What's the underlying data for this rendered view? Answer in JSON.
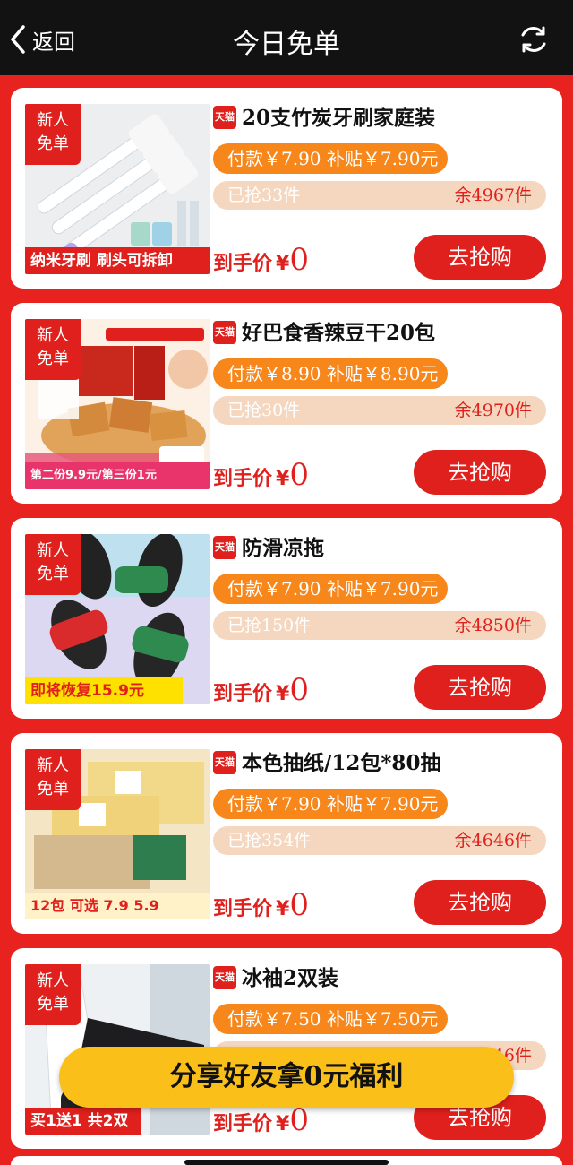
{
  "nav": {
    "back_label": "返回",
    "title": "今日免单"
  },
  "common": {
    "new_badge_line1": "新人",
    "new_badge_line2": "免单",
    "tmall_label": "天猫",
    "final_label": "到手价",
    "currency": "¥",
    "buy_label": "去抢购"
  },
  "products": [
    {
      "title": "20支竹炭牙刷家庭装",
      "price_text": "付款￥7.90  补贴￥7.90元",
      "grabbed": "已抢33件",
      "remaining": "余4967件",
      "final_value": "0",
      "thumb_caption": "纳米牙刷  刷头可拆卸"
    },
    {
      "title": "好巴食香辣豆干20包",
      "price_text": "付款￥8.90  补贴￥8.90元",
      "grabbed": "已抢30件",
      "remaining": "余4970件",
      "final_value": "0",
      "thumb_caption": "第二份9.9元/第三份1元"
    },
    {
      "title": "防滑凉拖",
      "price_text": "付款￥7.90  补贴￥7.90元",
      "grabbed": "已抢150件",
      "remaining": "余4850件",
      "final_value": "0",
      "thumb_caption": "即将恢复15.9元"
    },
    {
      "title": "本色抽纸/12包*80抽",
      "price_text": "付款￥7.90  补贴￥7.90元",
      "grabbed": "已抢354件",
      "remaining": "余4646件",
      "final_value": "0",
      "thumb_caption": "12包 可选 7.9  5.9"
    },
    {
      "title": "冰袖2双装",
      "price_text": "付款￥7.50  补贴￥7.50元",
      "grabbed": "",
      "remaining": "余4946件",
      "final_value": "0",
      "thumb_caption": "买1送1 共2双"
    }
  ],
  "share_button": "分享好友拿0元福利",
  "colors": {
    "background_red": "#e8231f",
    "accent_red": "#e0201c",
    "orange": "#f7871b",
    "share_yellow": "#fbbf1a",
    "navbar": "#121212"
  }
}
